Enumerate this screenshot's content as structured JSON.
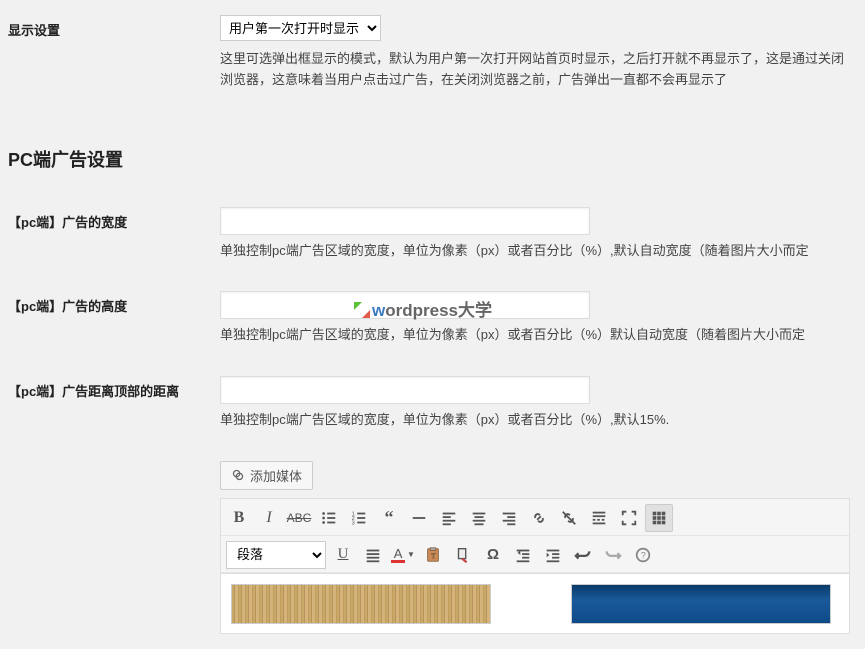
{
  "display_settings": {
    "label": "显示设置",
    "select_value": "用户第一次打开时显示",
    "description": "这里可选弹出框显示的模式，默认为用户第一次打开网站首页时显示，之后打开就不再显示了，这是通过关闭浏览器，这意味着当用户点击过广告，在关闭浏览器之前，广告弹出一直都不会再显示了"
  },
  "pc_section_heading": "PC端广告设置",
  "pc_width": {
    "label": "【pc端】广告的宽度",
    "value": "",
    "desc": "单独控制pc端广告区域的宽度，单位为像素（px）或者百分比（%）,默认自动宽度（随着图片大小而定"
  },
  "pc_height": {
    "label": "【pc端】广告的高度",
    "value": "",
    "desc": "单独控制pc端广告区域的宽度，单位为像素（px）或者百分比（%）默认自动宽度（随着图片大小而定"
  },
  "pc_top_offset": {
    "label": "【pc端】广告距离顶部的距离",
    "value": "",
    "desc": "单独控制pc端广告区域的宽度，单位为像素（px）或者百分比（%）,默认15%."
  },
  "editor": {
    "add_media_label": "添加媒体",
    "format_select": "段落"
  },
  "toolbar": {
    "row1": [
      "bold",
      "italic",
      "strike",
      "bullet-list",
      "numbered-list",
      "blockquote",
      "hr",
      "align-left",
      "align-center",
      "align-right",
      "link",
      "unlink",
      "insert-more",
      "fullscreen",
      "toggle-toolbar"
    ],
    "row2": [
      "underline",
      "align-justify",
      "text-color",
      "paste-text",
      "clear-format",
      "special-char",
      "outdent",
      "indent",
      "undo",
      "redo",
      "help"
    ]
  },
  "watermark": {
    "prefix": "w",
    "text": "ordpress大学"
  }
}
